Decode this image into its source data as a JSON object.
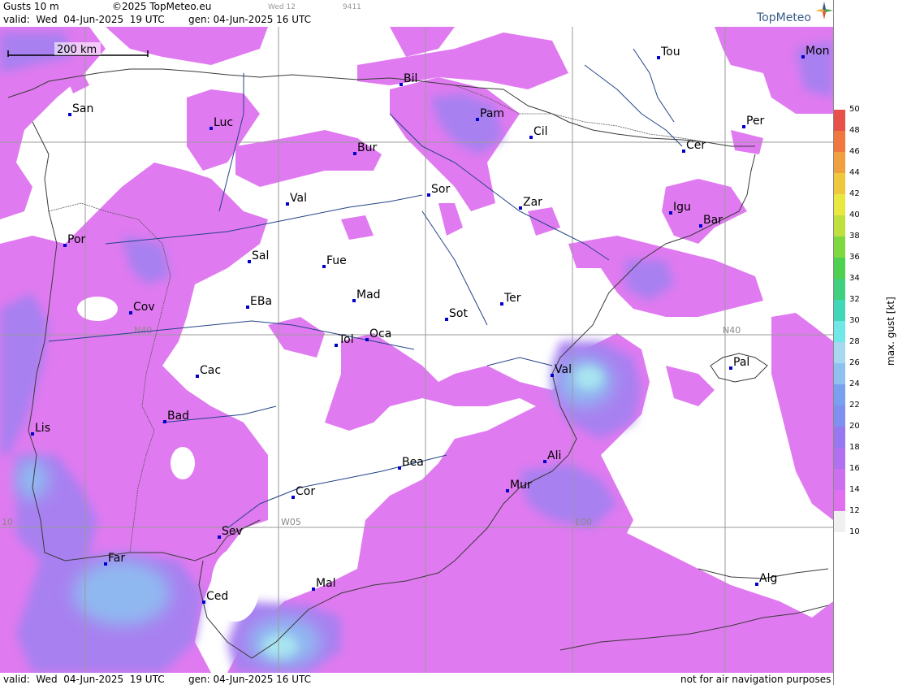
{
  "header": {
    "title": "Gusts 10 m",
    "copyright": "©2025 TopMeteo.eu",
    "day_label": "Wed 12",
    "code": "9411",
    "valid": "valid:  Wed  04-Jun-2025  19 UTC",
    "gen": "gen: 04-Jun-2025 16 UTC",
    "logo": "TopMeteo"
  },
  "footer": {
    "valid": "valid:  Wed  04-Jun-2025  19 UTC",
    "gen": "gen: 04-Jun-2025 16 UTC",
    "disclaimer": "not for air navigation purposes"
  },
  "scale": {
    "label": "200 km"
  },
  "legend": {
    "title": "max. gust  [kt]",
    "ticks": [
      "50",
      "48",
      "46",
      "44",
      "42",
      "40",
      "38",
      "36",
      "34",
      "32",
      "30",
      "28",
      "26",
      "24",
      "22",
      "20",
      "18",
      "16",
      "14",
      "12",
      "10"
    ],
    "colors": [
      "#e8504a",
      "#f07840",
      "#f0a040",
      "#f0c840",
      "#e8e840",
      "#c0e040",
      "#80d840",
      "#50d050",
      "#40d080",
      "#40d8b8",
      "#70e8e8",
      "#a8d8f0",
      "#90c0f0",
      "#7aa0f0",
      "#8090f0",
      "#9878f0",
      "#b070f0",
      "#cc70f0",
      "#e070f0",
      "#f0f0f0"
    ]
  },
  "grid_labels": {
    "n40_left": "N40",
    "n40_right": "N40",
    "w05": "W05",
    "e00": "E00",
    "w10": "10"
  },
  "cities": [
    {
      "id": "san",
      "name": "San"
    },
    {
      "id": "luc",
      "name": "Luc"
    },
    {
      "id": "bil",
      "name": "Bil"
    },
    {
      "id": "pam",
      "name": "Pam"
    },
    {
      "id": "cil",
      "name": "Cil"
    },
    {
      "id": "tou",
      "name": "Tou"
    },
    {
      "id": "mon",
      "name": "Mon"
    },
    {
      "id": "per",
      "name": "Per"
    },
    {
      "id": "cer",
      "name": "Cer"
    },
    {
      "id": "bur",
      "name": "Bur"
    },
    {
      "id": "val1",
      "name": "Val"
    },
    {
      "id": "sor",
      "name": "Sor"
    },
    {
      "id": "zar",
      "name": "Zar"
    },
    {
      "id": "igu",
      "name": "Igu"
    },
    {
      "id": "bar",
      "name": "Bar"
    },
    {
      "id": "por",
      "name": "Por"
    },
    {
      "id": "sal",
      "name": "Sal"
    },
    {
      "id": "fue",
      "name": "Fue"
    },
    {
      "id": "mad",
      "name": "Mad"
    },
    {
      "id": "ter",
      "name": "Ter"
    },
    {
      "id": "cov",
      "name": "Cov"
    },
    {
      "id": "eba",
      "name": "EBa"
    },
    {
      "id": "sot",
      "name": "Sot"
    },
    {
      "id": "tol",
      "name": "Tol"
    },
    {
      "id": "oca",
      "name": "Oca"
    },
    {
      "id": "pal",
      "name": "Pal"
    },
    {
      "id": "cac",
      "name": "Cac"
    },
    {
      "id": "val2",
      "name": "Val"
    },
    {
      "id": "bad",
      "name": "Bad"
    },
    {
      "id": "lis",
      "name": "Lis"
    },
    {
      "id": "ali",
      "name": "Ali"
    },
    {
      "id": "bea",
      "name": "Bea"
    },
    {
      "id": "mur",
      "name": "Mur"
    },
    {
      "id": "cor",
      "name": "Cor"
    },
    {
      "id": "sev",
      "name": "Sev"
    },
    {
      "id": "far",
      "name": "Far"
    },
    {
      "id": "mal",
      "name": "Mal"
    },
    {
      "id": "ced",
      "name": "Ced"
    },
    {
      "id": "alg",
      "name": "Alg"
    }
  ]
}
